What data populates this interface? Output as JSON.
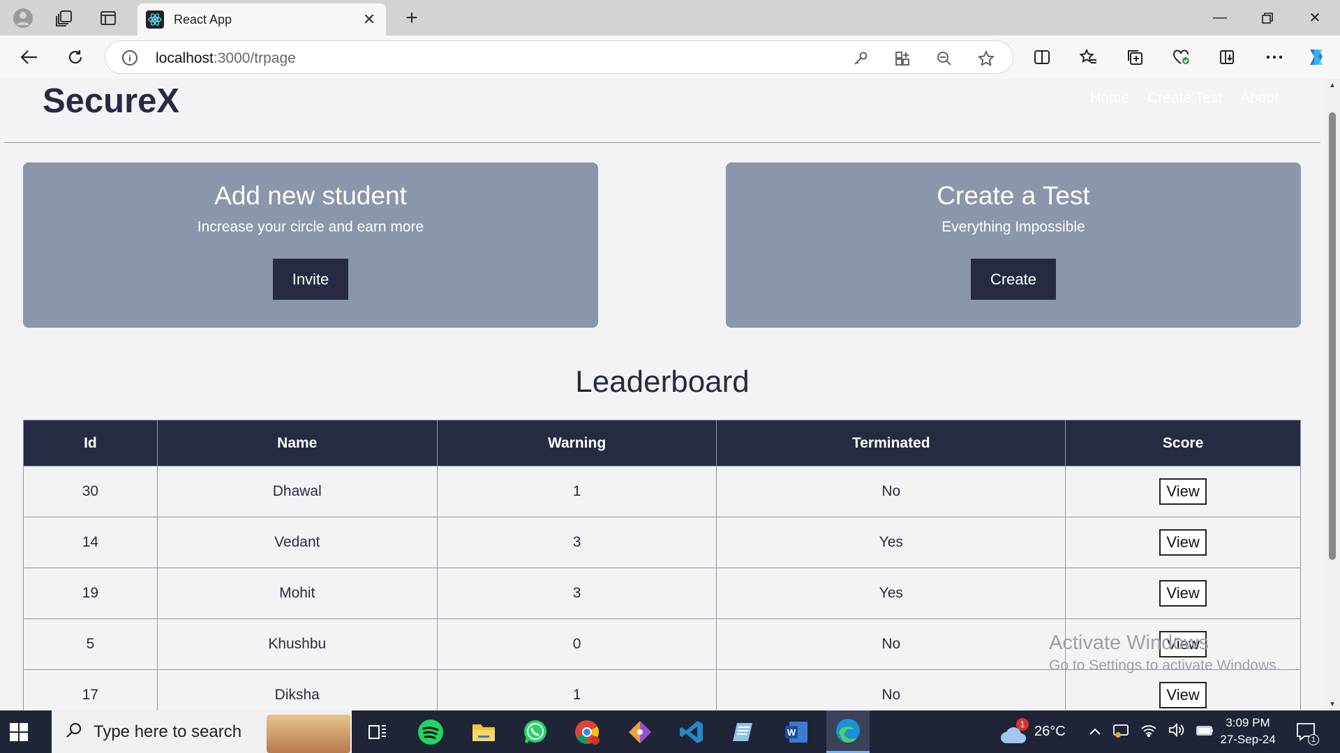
{
  "browser": {
    "tab_title": "React App",
    "url_host": "localhost",
    "url_path": ":3000/trpage"
  },
  "navbar": {
    "brand": "SecureX",
    "links": [
      "Home",
      "Create Test",
      "About"
    ]
  },
  "cards": [
    {
      "title": "Add new student",
      "subtitle": "Increase your circle and earn more",
      "button": "Invite"
    },
    {
      "title": "Create a Test",
      "subtitle": "Everything Impossible",
      "button": "Create"
    }
  ],
  "leaderboard": {
    "title": "Leaderboard",
    "headers": [
      "Id",
      "Name",
      "Warning",
      "Terminated",
      "Score"
    ],
    "rows": [
      {
        "id": "30",
        "name": "Dhawal",
        "warning": "1",
        "terminated": "No",
        "action": "View"
      },
      {
        "id": "14",
        "name": "Vedant",
        "warning": "3",
        "terminated": "Yes",
        "action": "View"
      },
      {
        "id": "19",
        "name": "Mohit",
        "warning": "3",
        "terminated": "Yes",
        "action": "View"
      },
      {
        "id": "5",
        "name": "Khushbu",
        "warning": "0",
        "terminated": "No",
        "action": "View"
      },
      {
        "id": "17",
        "name": "Diksha",
        "warning": "1",
        "terminated": "No",
        "action": "View"
      }
    ]
  },
  "watermark": {
    "line1": "Activate Windows",
    "line2": "Go to Settings to activate Windows."
  },
  "taskbar": {
    "search_placeholder": "Type here to search",
    "temperature": "26°C",
    "weather_badge": "1",
    "time": "3:09 PM",
    "date": "27-Sep-24",
    "notification_count": "1"
  },
  "colors": {
    "primary_dark": "#262b42",
    "card_bg": "#8b96ab",
    "page_bg": "#f2f3f5",
    "taskbar_bg": "#1f2437"
  }
}
